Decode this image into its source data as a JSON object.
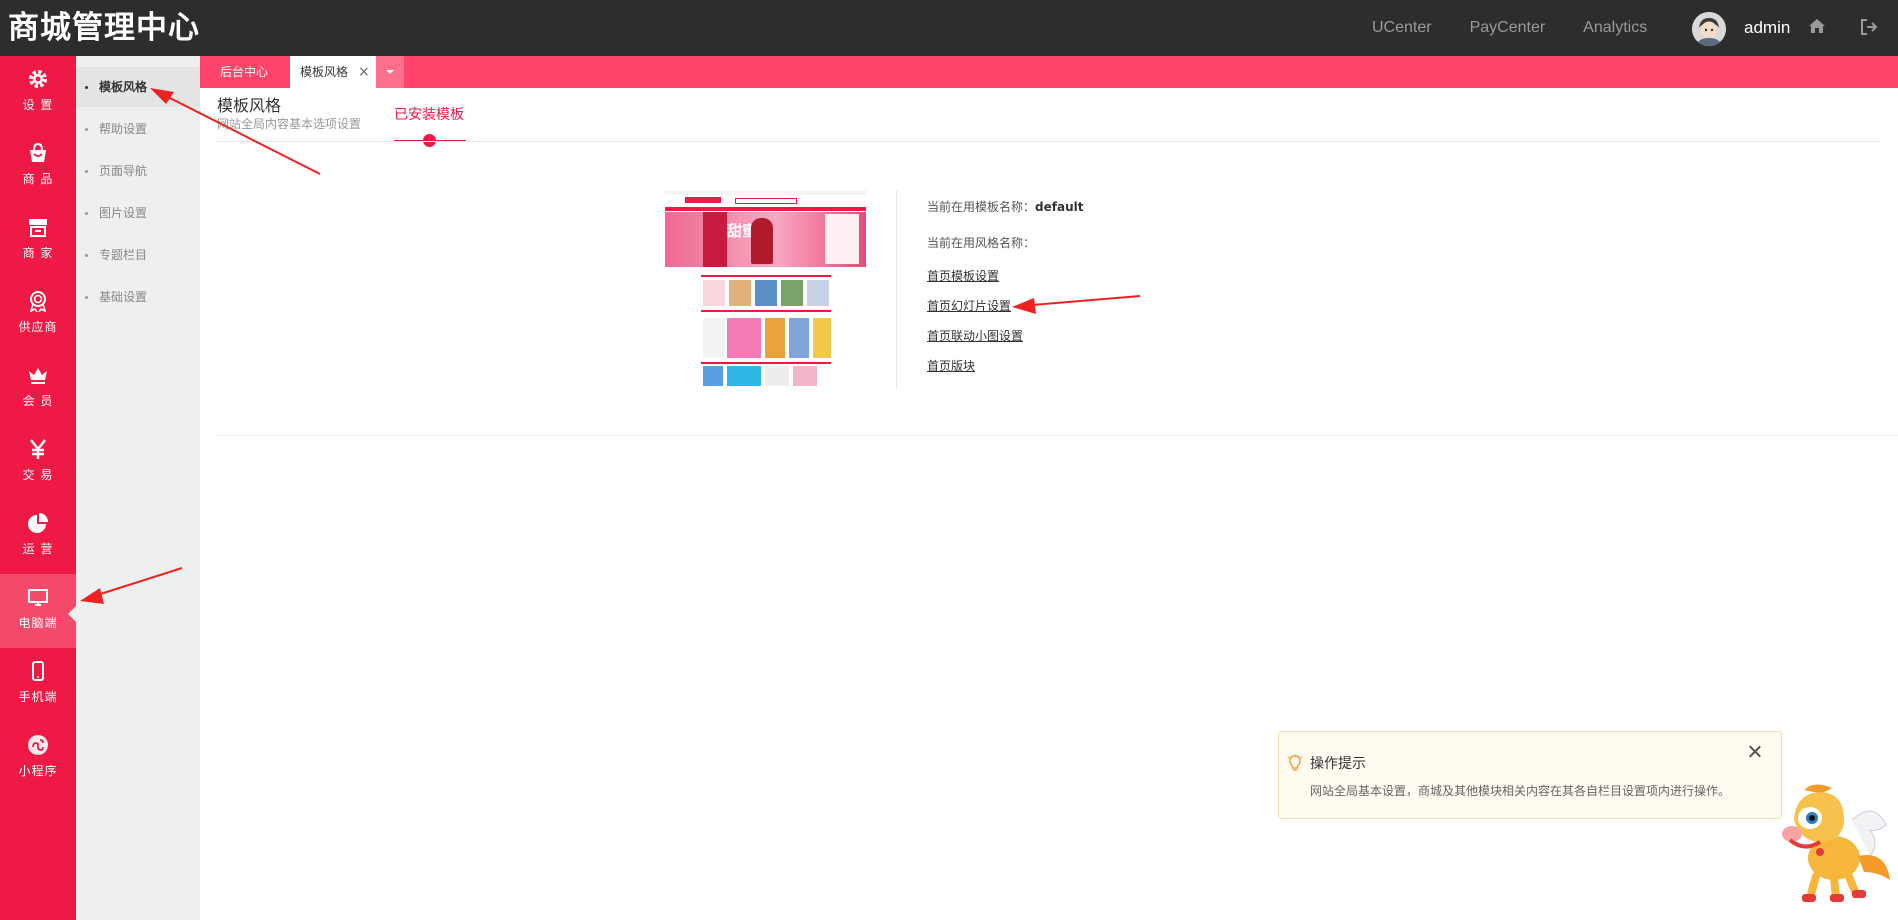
{
  "app": {
    "title": "商城管理中心"
  },
  "topnav": {
    "links": [
      "UCenter",
      "PayCenter",
      "Analytics"
    ],
    "username": "admin"
  },
  "mainnav": {
    "items": [
      {
        "label": "设 置",
        "icon": "gear-icon"
      },
      {
        "label": "商 品",
        "icon": "shopping-bag-icon"
      },
      {
        "label": "商 家",
        "icon": "store-icon"
      },
      {
        "label": "供应商",
        "icon": "medal-icon"
      },
      {
        "label": "会 员",
        "icon": "crown-icon"
      },
      {
        "label": "交 易",
        "icon": "yen-icon"
      },
      {
        "label": "运 营",
        "icon": "pie-chart-icon"
      },
      {
        "label": "电脑端",
        "icon": "monitor-icon",
        "active": true
      },
      {
        "label": "手机端",
        "icon": "mobile-icon"
      },
      {
        "label": "小程序",
        "icon": "mini-program-icon"
      }
    ]
  },
  "subnav": {
    "items": [
      {
        "label": "模板风格",
        "active": true
      },
      {
        "label": "帮助设置"
      },
      {
        "label": "页面导航"
      },
      {
        "label": "图片设置"
      },
      {
        "label": "专题栏目"
      },
      {
        "label": "基础设置"
      }
    ]
  },
  "tabs": {
    "home": "后台中心",
    "current": "模板风格",
    "close": "×"
  },
  "page": {
    "title": "模板风格",
    "description": "网站全局内容基本选项设置",
    "active_tab": "已安装模板"
  },
  "template": {
    "current_template_label": "当前在用模板名称：",
    "current_template_value": "default",
    "current_style_label": "当前在用风格名称：",
    "links": [
      "首页模板设置",
      "首页幻灯片设置",
      "首页联动小图设置",
      "首页版块"
    ],
    "thumb_banner_text": "甜蜜"
  },
  "tip": {
    "title": "操作提示",
    "text": "网站全局基本设置，商城及其他模块相关内容在其各自栏目设置项内进行操作。"
  },
  "colors": {
    "primary": "#ee1a45",
    "tabstrip": "#ff4469",
    "topbar": "#2d2d2d",
    "subnav_bg": "#efefef"
  }
}
